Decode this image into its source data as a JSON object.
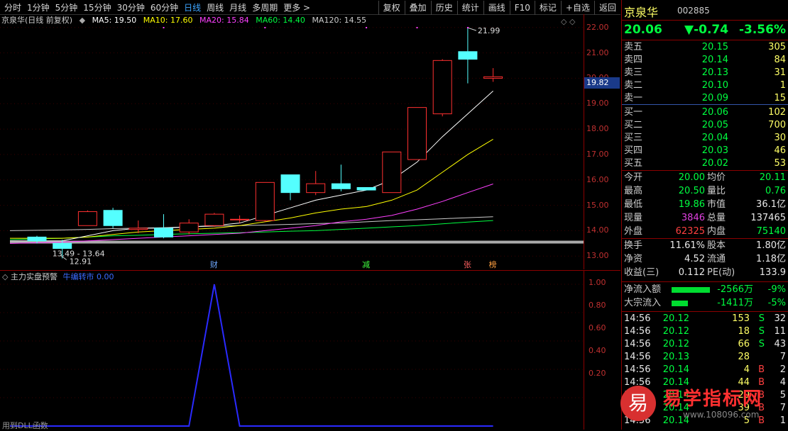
{
  "toolbar": {
    "periods": [
      "分时",
      "1分钟",
      "5分钟",
      "15分钟",
      "30分钟",
      "60分钟",
      "日线",
      "周线",
      "月线",
      "多周期",
      "更多 >"
    ],
    "active": "日线",
    "actions": [
      "复权",
      "叠加",
      "历史",
      "统计",
      "画线",
      "F10",
      "标记",
      "+自选",
      "返回"
    ]
  },
  "legend": {
    "title": "京泉华(日线 前复权)",
    "ma5": "MA5: 19.50",
    "ma10": "MA10: 17.60",
    "ma20": "MA20: 15.84",
    "ma60": "MA60: 14.40",
    "ma120": "MA120: 14.55",
    "colors": {
      "title": "#cccccc",
      "ma5": "#ffffff",
      "ma10": "#ffff00",
      "ma20": "#ff40ff",
      "ma60": "#00ff40",
      "ma120": "#cccccc"
    }
  },
  "price_axis": {
    "ticks": [
      "22.00",
      "21.00",
      "20.00",
      "19.00",
      "18.00",
      "17.00",
      "16.00",
      "15.00",
      "14.00",
      "13.00"
    ],
    "current": "19.82"
  },
  "chart_data": {
    "type": "candlestick",
    "ylim": [
      12.7,
      22.3
    ],
    "candles": [
      {
        "o": 13.75,
        "c": 13.6,
        "h": 13.8,
        "l": 13.5
      },
      {
        "o": 13.5,
        "c": 13.3,
        "h": 13.64,
        "l": 12.91
      },
      {
        "o": 14.2,
        "c": 14.75,
        "h": 14.8,
        "l": 14.2
      },
      {
        "o": 14.8,
        "c": 14.2,
        "h": 14.9,
        "l": 14.1
      },
      {
        "o": 14.05,
        "c": 14.1,
        "h": 14.4,
        "l": 13.9
      },
      {
        "o": 14.1,
        "c": 13.75,
        "h": 14.65,
        "l": 13.7
      },
      {
        "o": 13.95,
        "c": 14.3,
        "h": 14.45,
        "l": 13.85
      },
      {
        "o": 14.2,
        "c": 14.65,
        "h": 14.7,
        "l": 14.15
      },
      {
        "o": 14.45,
        "c": 14.45,
        "h": 14.6,
        "l": 14.3
      },
      {
        "o": 14.4,
        "c": 15.9,
        "h": 15.9,
        "l": 14.35
      },
      {
        "o": 16.2,
        "c": 15.5,
        "h": 16.2,
        "l": 15.2
      },
      {
        "o": 15.5,
        "c": 15.85,
        "h": 16.35,
        "l": 15.4
      },
      {
        "o": 15.85,
        "c": 15.65,
        "h": 16.6,
        "l": 15.55
      },
      {
        "o": 15.7,
        "c": 15.6,
        "h": 15.7,
        "l": 15.6
      },
      {
        "o": 15.5,
        "c": 17.1,
        "h": 17.1,
        "l": 15.5
      },
      {
        "o": 16.8,
        "c": 18.85,
        "h": 18.85,
        "l": 16.8
      },
      {
        "o": 18.6,
        "c": 20.7,
        "h": 20.75,
        "l": 18.5
      },
      {
        "o": 21.05,
        "c": 20.75,
        "h": 21.99,
        "l": 19.8
      },
      {
        "o": 20.0,
        "c": 20.06,
        "h": 20.4,
        "l": 19.86
      }
    ],
    "ma5": [
      13.6,
      13.6,
      13.8,
      14.0,
      14.1,
      14.1,
      14.15,
      14.2,
      14.3,
      14.6,
      14.9,
      15.2,
      15.4,
      15.6,
      16.0,
      16.7,
      17.7,
      18.6,
      19.5
    ],
    "ma10": [
      13.7,
      13.7,
      13.75,
      13.85,
      13.95,
      14.0,
      14.05,
      14.1,
      14.2,
      14.35,
      14.5,
      14.7,
      14.85,
      14.95,
      15.2,
      15.6,
      16.3,
      17.0,
      17.6
    ],
    "ma20": [
      13.5,
      13.55,
      13.6,
      13.65,
      13.7,
      13.75,
      13.8,
      13.85,
      13.9,
      14.0,
      14.1,
      14.2,
      14.35,
      14.45,
      14.6,
      14.85,
      15.15,
      15.5,
      15.84
    ],
    "ma60": [
      13.65,
      13.7,
      13.75,
      13.8,
      13.82,
      13.85,
      13.88,
      13.9,
      13.92,
      13.95,
      13.98,
      14.0,
      14.05,
      14.1,
      14.15,
      14.2,
      14.27,
      14.34,
      14.4
    ],
    "ma120": [
      14.0,
      14.03,
      14.05,
      14.08,
      14.1,
      14.12,
      14.15,
      14.18,
      14.2,
      14.22,
      14.25,
      14.28,
      14.3,
      14.35,
      14.4,
      14.43,
      14.47,
      14.51,
      14.55
    ],
    "annotations": {
      "high": "21.99",
      "low": "12.91",
      "range": "13.49 - 13.64"
    },
    "markers": [
      {
        "text": "财",
        "index": 7,
        "color": "#6fa8ff"
      },
      {
        "text": "减",
        "index": 13,
        "color": "#40ff40"
      },
      {
        "text": "张",
        "index": 17,
        "color": "#ff6060"
      },
      {
        "text": "榜",
        "index": 18,
        "color": "#ffa040"
      }
    ]
  },
  "indicator": {
    "title": "主力实盘预警",
    "sub_label": "牛编转市",
    "value": "0.00",
    "ticks": [
      "1.00",
      "0.80",
      "0.60",
      "0.40",
      "0.20"
    ],
    "values": [
      0,
      0,
      0,
      0,
      0,
      0,
      0,
      1,
      0,
      0,
      0,
      0,
      0,
      0,
      0,
      0,
      0,
      0,
      0
    ],
    "footer": "用到DLL函数"
  },
  "quote": {
    "name": "京泉华",
    "code": "002885",
    "price": "20.06",
    "change": "▼-0.74",
    "change_pct": "-3.56%",
    "asks": [
      {
        "label": "卖五",
        "price": "20.15",
        "vol": "305"
      },
      {
        "label": "卖四",
        "price": "20.14",
        "vol": "84"
      },
      {
        "label": "卖三",
        "price": "20.13",
        "vol": "31"
      },
      {
        "label": "卖二",
        "price": "20.10",
        "vol": "1"
      },
      {
        "label": "卖一",
        "price": "20.09",
        "vol": "15"
      }
    ],
    "bids": [
      {
        "label": "买一",
        "price": "20.06",
        "vol": "102"
      },
      {
        "label": "买二",
        "price": "20.05",
        "vol": "700"
      },
      {
        "label": "买三",
        "price": "20.04",
        "vol": "30"
      },
      {
        "label": "买四",
        "price": "20.03",
        "vol": "46"
      },
      {
        "label": "买五",
        "price": "20.02",
        "vol": "53"
      }
    ],
    "stats": [
      {
        "l1": "今开",
        "v1": "20.00",
        "c1": "green",
        "l2": "均价",
        "v2": "20.11"
      },
      {
        "l1": "最高",
        "v1": "20.50",
        "c1": "green",
        "l2": "量比",
        "v2": "0.76"
      },
      {
        "l1": "最低",
        "v1": "19.86",
        "c1": "green",
        "l2": "市值",
        "v2": "36.1亿"
      },
      {
        "l1": "现量",
        "v1": "3846",
        "c1": "purple",
        "l2": "总量",
        "v2": "137465"
      },
      {
        "l1": "外盘",
        "v1": "62325",
        "c1": "red",
        "l2": "内盘",
        "v2": "75140"
      }
    ],
    "fund": [
      {
        "l1": "换手",
        "v1": "11.61%",
        "l2": "股本",
        "v2": "1.80亿"
      },
      {
        "l1": "净资",
        "v1": "4.52",
        "l2": "流通",
        "v2": "1.18亿"
      },
      {
        "l1": "收益(三)",
        "v1": "0.112",
        "l2": "PE(动)",
        "v2": "133.9"
      }
    ],
    "flow": [
      {
        "label": "净流入额",
        "value": "-2566万",
        "pct": "-9%",
        "bar": 0.72
      },
      {
        "label": "大宗流入",
        "value": "-1411万",
        "pct": "-5%",
        "bar": 0.3
      }
    ],
    "ticks": [
      {
        "t": "14:56",
        "p": "20.12",
        "v": "153",
        "s": "S",
        "n": "32"
      },
      {
        "t": "14:56",
        "p": "20.12",
        "v": "18",
        "s": "S",
        "n": "11"
      },
      {
        "t": "14:56",
        "p": "20.12",
        "v": "66",
        "s": "S",
        "n": "43"
      },
      {
        "t": "14:56",
        "p": "20.13",
        "v": "28",
        "s": "",
        "n": "7"
      },
      {
        "t": "14:56",
        "p": "20.14",
        "v": "4",
        "s": "B",
        "n": "2"
      },
      {
        "t": "14:56",
        "p": "20.14",
        "v": "44",
        "s": "B",
        "n": "4"
      },
      {
        "t": "14:56",
        "p": "20.14",
        "v": "20",
        "s": "B",
        "n": "5"
      },
      {
        "t": "14:56",
        "p": "20.14",
        "v": "39",
        "s": "B",
        "n": "7"
      },
      {
        "t": "14:56",
        "p": "20.14",
        "v": "5",
        "s": "B",
        "n": "1"
      }
    ]
  },
  "watermark": {
    "text": "易学指标网",
    "url": "www.108096.com",
    "logo_char": "易"
  }
}
